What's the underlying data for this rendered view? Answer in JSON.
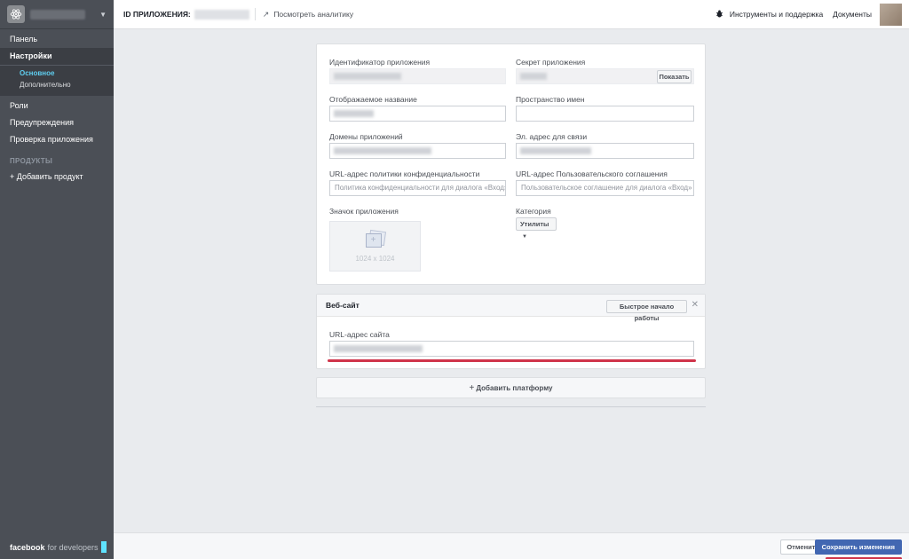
{
  "sidebar": {
    "items": [
      {
        "label": "Панель"
      },
      {
        "label": "Настройки"
      },
      {
        "label": "Роли"
      },
      {
        "label": "Предупреждения"
      },
      {
        "label": "Проверка приложения"
      }
    ],
    "sub_items": [
      {
        "label": "Основное"
      },
      {
        "label": "Дополнительно"
      }
    ],
    "section_products": "ПРОДУКТЫ",
    "add_product": "+ Добавить продукт",
    "footer_brand": "facebook",
    "footer_suffix": "for developers"
  },
  "topbar": {
    "app_id_label": "ID ПРИЛОЖЕНИЯ:",
    "analytics_label": "Посмотреть аналитику",
    "tools_label": "Инструменты и поддержка",
    "docs_label": "Документы"
  },
  "basic": {
    "app_id_label": "Идентификатор приложения",
    "app_secret_label": "Секрет приложения",
    "show_button": "Показать",
    "display_name_label": "Отображаемое название",
    "namespace_label": "Пространство имен",
    "app_domains_label": "Домены приложений",
    "contact_email_label": "Эл. адрес для связи",
    "privacy_url_label": "URL-адрес политики конфиденциальности",
    "privacy_url_placeholder": "Политика конфиденциальности для диалога «Вход»",
    "terms_url_label": "URL-адрес Пользовательского соглашения",
    "terms_url_placeholder": "Пользовательское соглашение для диалога «Вход»",
    "app_icon_label": "Значок приложения",
    "app_icon_size": "1024 x 1024",
    "category_label": "Категория",
    "category_value": "Утилиты"
  },
  "website": {
    "title": "Веб-сайт",
    "quick_start": "Быстрое начало работы",
    "site_url_label": "URL-адрес сайта"
  },
  "add_platform": "Добавить платформу",
  "footer": {
    "cancel": "Отменить",
    "save": "Сохранить изменения"
  },
  "colors": {
    "accent": "#4267b2",
    "sidebar_bg": "#4b4f56",
    "highlight_underline": "#d0344a"
  }
}
